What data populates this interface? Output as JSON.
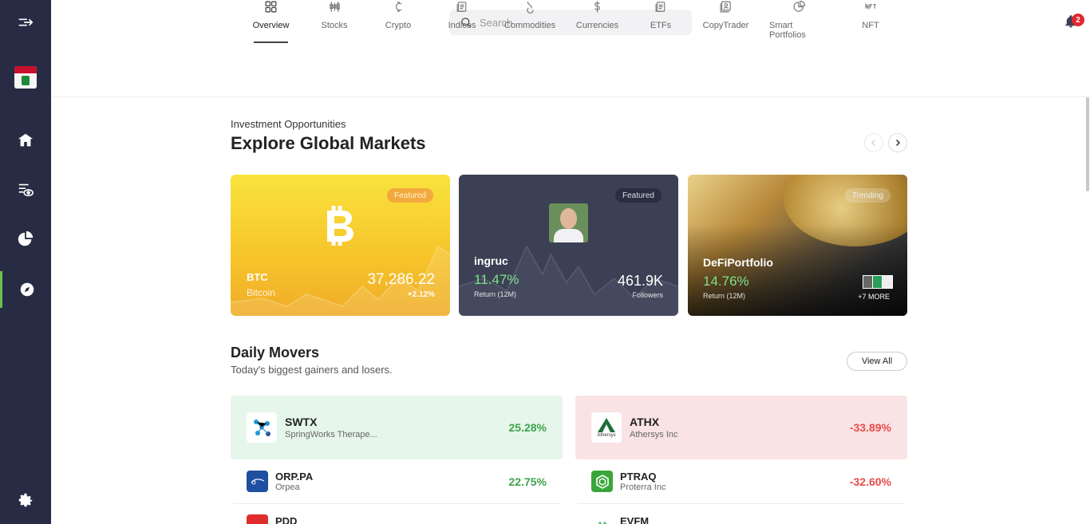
{
  "search": {
    "placeholder": "Search"
  },
  "notifications": {
    "count": "2"
  },
  "tabs": [
    {
      "label": "Overview",
      "icon": "grid-icon",
      "active": true
    },
    {
      "label": "Stocks",
      "icon": "candles-icon"
    },
    {
      "label": "Crypto",
      "icon": "crypto-icon"
    },
    {
      "label": "Indices",
      "icon": "indices-icon"
    },
    {
      "label": "Commodities",
      "icon": "commodities-icon"
    },
    {
      "label": "Currencies",
      "icon": "dollar-icon"
    },
    {
      "label": "ETFs",
      "icon": "etf-icon"
    },
    {
      "label": "CopyTrader",
      "icon": "copytrader-icon"
    },
    {
      "label": "Smart Portfolios",
      "icon": "pie-icon"
    },
    {
      "label": "NFT",
      "icon": "nft-icon"
    }
  ],
  "header": {
    "kicker": "Investment Opportunities",
    "title": "Explore Global Markets"
  },
  "cards": {
    "btc": {
      "badge": "Featured",
      "symbol": "BTC",
      "name": "Bitcoin",
      "price": "37,286.22",
      "change": "+2.12%"
    },
    "user": {
      "badge": "Featured",
      "name": "ingruc",
      "return": "11.47%",
      "return_label": "Return (12M)",
      "followers": "461.9K",
      "followers_label": "Followers"
    },
    "defi": {
      "badge": "Trending",
      "name": "DeFiPortfolio",
      "return": "14.76%",
      "return_label": "Return (12M)",
      "more": "+7 MORE"
    }
  },
  "movers": {
    "title": "Daily Movers",
    "subtitle": "Today's biggest gainers and losers.",
    "view_all": "View All",
    "gainers": [
      {
        "symbol": "SWTX",
        "name": "SpringWorks Therape...",
        "pct": "25.28%"
      },
      {
        "symbol": "ORP.PA",
        "name": "Orpea",
        "pct": "22.75%"
      },
      {
        "symbol": "PDD",
        "name": "",
        "pct": ""
      }
    ],
    "losers": [
      {
        "symbol": "ATHX",
        "name": "Athersys Inc",
        "pct": "-33.89%",
        "logo_text": "Athersys"
      },
      {
        "symbol": "PTRAQ",
        "name": "Proterra Inc",
        "pct": "-32.60%"
      },
      {
        "symbol": "EVFM",
        "name": "",
        "pct": ""
      }
    ]
  },
  "colors": {
    "sidebar": "#272c44",
    "gain": "#3fa34d",
    "loss": "#e64c4c",
    "accent": "#6bc24a"
  }
}
